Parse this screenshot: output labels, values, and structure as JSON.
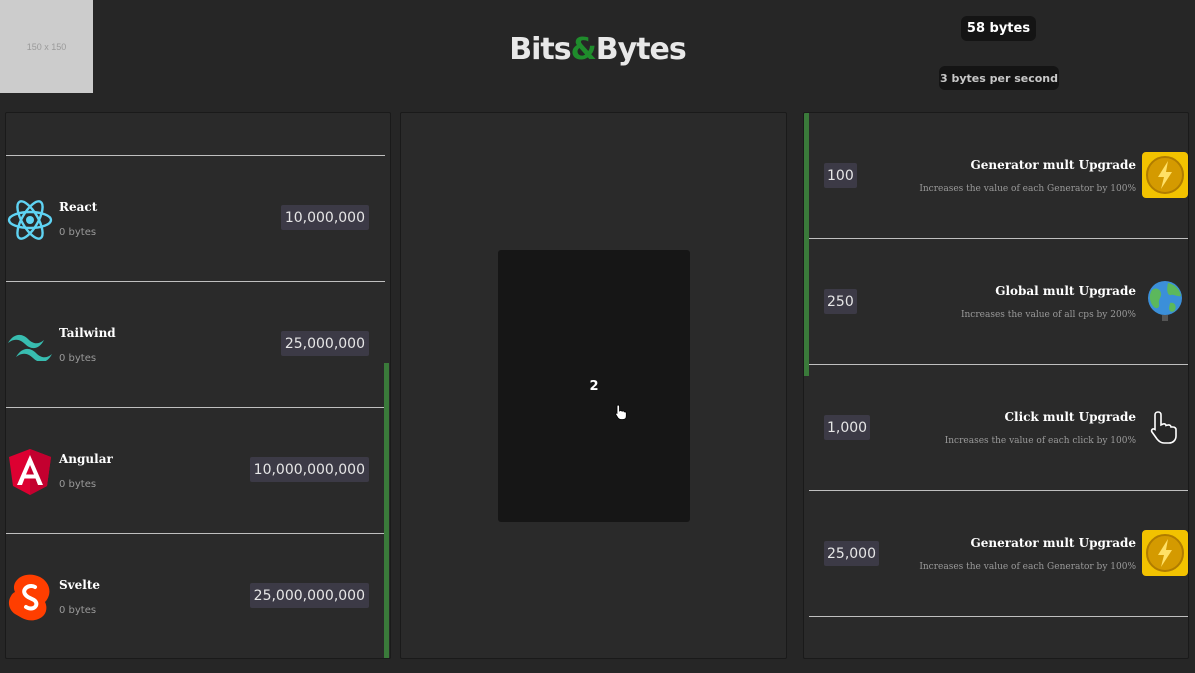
{
  "placeholder": {
    "label": "150 x 150"
  },
  "header": {
    "logo_left": "Bits",
    "logo_amp": "&",
    "logo_right": "Bytes",
    "bytes": "58 bytes",
    "bytes_per_second": "3 bytes per second"
  },
  "colors": {
    "background": "#262626",
    "panel": "#2a2a2a",
    "accent_green": "#1f8c2c",
    "scrollbar": "#3a7a3a",
    "price_badge": "#3c3a46",
    "click_area": "#161616"
  },
  "generators": [
    {
      "name": "React",
      "owned": "0 bytes",
      "price": "10,000,000",
      "icon": "react-icon"
    },
    {
      "name": "Tailwind",
      "owned": "0 bytes",
      "price": "25,000,000",
      "icon": "tailwind-icon"
    },
    {
      "name": "Angular",
      "owned": "0 bytes",
      "price": "10,000,000,000",
      "icon": "angular-icon"
    },
    {
      "name": "Svelte",
      "owned": "0 bytes",
      "price": "25,000,000,000",
      "icon": "svelte-icon"
    }
  ],
  "clicker": {
    "count": "2"
  },
  "upgrades": [
    {
      "price": "100",
      "name": "Generator mult Upgrade",
      "description": "Increases the value of each Generator by 100%",
      "icon": "lightning-coin-icon"
    },
    {
      "price": "250",
      "name": "Global mult Upgrade",
      "description": "Increases the value of all cps by 200%",
      "icon": "globe-icon"
    },
    {
      "price": "1,000",
      "name": "Click mult Upgrade",
      "description": "Increases the value of each click by 100%",
      "icon": "hand-cursor-icon"
    },
    {
      "price": "25,000",
      "name": "Generator mult Upgrade",
      "description": "Increases the value of each Generator by 100%",
      "icon": "lightning-coin-icon"
    }
  ]
}
